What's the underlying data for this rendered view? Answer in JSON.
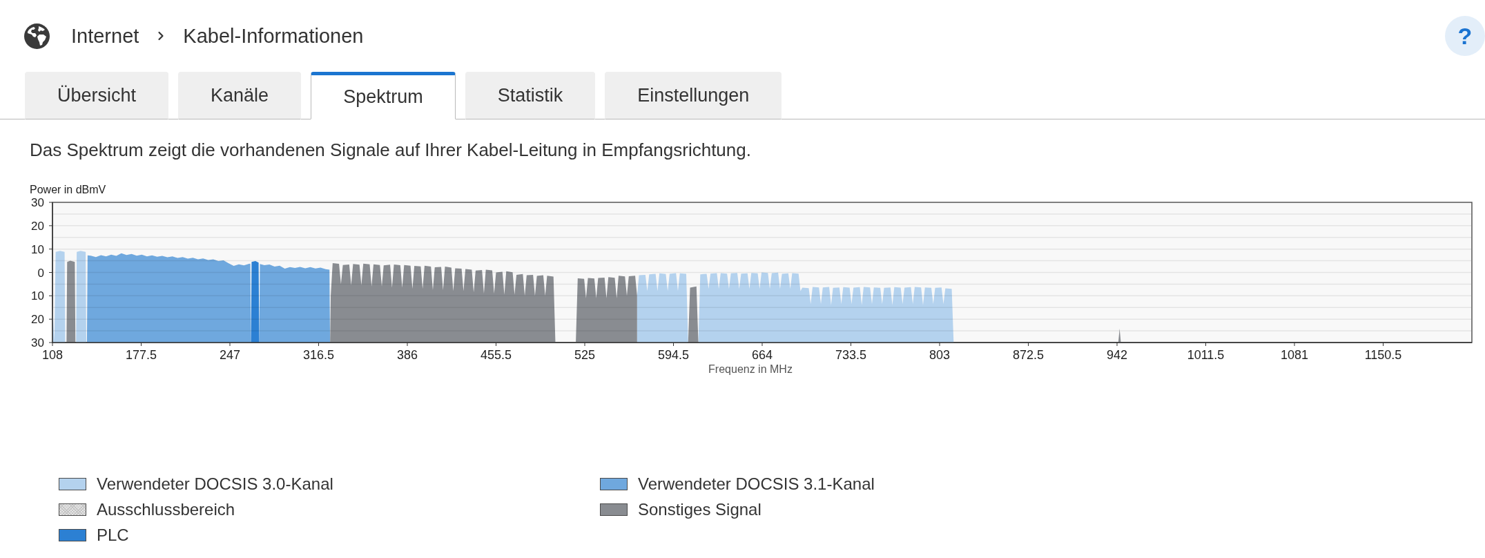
{
  "breadcrumb": [
    "Internet",
    "Kabel-Informationen"
  ],
  "help_button": {
    "label": "?"
  },
  "tabs": [
    {
      "label": "Übersicht",
      "selected": false
    },
    {
      "label": "Kanäle",
      "selected": false
    },
    {
      "label": "Spektrum",
      "selected": true
    },
    {
      "label": "Statistik",
      "selected": false
    },
    {
      "label": "Einstellungen",
      "selected": false
    }
  ],
  "description": "Das Spektrum zeigt die vorhandenen Signale auf Ihrer Kabel-Leitung in Empfangsrichtung.",
  "spectrum_chart": {
    "chart_data": {
      "type": "area",
      "grid": true,
      "xlabel": "Frequenz in MHz",
      "ylabel": "Power in dBmV",
      "xlim": [
        108,
        1220
      ],
      "ylim": [
        -30,
        30
      ],
      "xticks": [
        108,
        177.5,
        247,
        316.5,
        386,
        455.5,
        525,
        594.5,
        664,
        733.5,
        803,
        872.5,
        942,
        1011.5,
        1081,
        1150.5
      ],
      "yticks": [
        30,
        20,
        10,
        0,
        {
          "value": -10,
          "label": "10"
        },
        {
          "value": -20,
          "label": "20"
        },
        {
          "value": -30,
          "label": "30"
        }
      ],
      "x": [
        108,
        109.5,
        110.5,
        114,
        117.5,
        118,
        119,
        119.5,
        122,
        125.5,
        126,
        126.5,
        127,
        130,
        134,
        134.5,
        135,
        135.5,
        138,
        142,
        146,
        150,
        154,
        158,
        162,
        166,
        170,
        174,
        178,
        182,
        186,
        190,
        194,
        198,
        202,
        206,
        210,
        214,
        218,
        222,
        226,
        230,
        234,
        238,
        242,
        246,
        250,
        254,
        258,
        262,
        263,
        263.5,
        264,
        267,
        269.5,
        270,
        270.5,
        274,
        278,
        282,
        286,
        290,
        294,
        298,
        302,
        306,
        310,
        314,
        318,
        322,
        325,
        325.5,
        326,
        327.5,
        332.5,
        334,
        335.5,
        340.5,
        342,
        343.5,
        348.5,
        350,
        351.5,
        356.5,
        358,
        359.5,
        364.5,
        366,
        367.5,
        372.5,
        374,
        375.5,
        380.5,
        382,
        383.5,
        388.5,
        390,
        391.5,
        396.5,
        398,
        399.5,
        404.5,
        406,
        407.5,
        412.5,
        414,
        415.5,
        420.5,
        422,
        423.5,
        428.5,
        430,
        431.5,
        436.5,
        438,
        439.5,
        444.5,
        446,
        447.5,
        452.5,
        454,
        455.5,
        460.5,
        462,
        463.5,
        468.5,
        470,
        471.5,
        476.5,
        478,
        479.5,
        484.5,
        486,
        487.5,
        492.5,
        494,
        495.5,
        500.5,
        502,
        518,
        519.5,
        524.5,
        526,
        527.5,
        532.5,
        534,
        535.5,
        540.5,
        542,
        543.5,
        548.5,
        550,
        551.5,
        556.5,
        558,
        559.5,
        564.5,
        566,
        567.5,
        572.5,
        574,
        575.5,
        580.5,
        582,
        583.5,
        588.5,
        590,
        591.5,
        596.5,
        598,
        599.5,
        604.5,
        606,
        607.5,
        612.5,
        614,
        615.5,
        620.5,
        622,
        623.5,
        628.5,
        630,
        631.5,
        636.5,
        638,
        639.5,
        644.5,
        646,
        647.5,
        652.5,
        654,
        655.5,
        660.5,
        662,
        663.5,
        668.5,
        670,
        671.5,
        676.5,
        678,
        679.5,
        684.5,
        686,
        687.5,
        692.5,
        694,
        695.5,
        700.5,
        702,
        703.5,
        708.5,
        710,
        711.5,
        716.5,
        718,
        719.5,
        724.5,
        726,
        727.5,
        732.5,
        734,
        735.5,
        740.5,
        742,
        743.5,
        748.5,
        750,
        751.5,
        756.5,
        758,
        759.5,
        764.5,
        766,
        767.5,
        772.5,
        774,
        775.5,
        780.5,
        782,
        783.5,
        788.5,
        790,
        791.5,
        796.5,
        798,
        799.5,
        804.5,
        806,
        807.5,
        812.5,
        814,
        943,
        944,
        945
      ],
      "series": [
        {
          "color": "#b4d2ee",
          "values": [
            -13,
            -30,
            8.8,
            9.2,
            8.8,
            -30,
            null,
            null,
            null,
            null,
            null,
            -30,
            8.8,
            9.2,
            8.8,
            -30,
            null,
            null,
            null,
            null,
            null,
            null,
            null,
            null,
            null,
            null,
            null,
            null,
            null,
            null,
            null,
            null,
            null,
            null,
            null,
            null,
            null,
            null,
            null,
            null,
            null,
            null,
            null,
            null,
            null,
            null,
            null,
            null,
            null,
            null,
            null,
            null,
            null,
            null,
            null,
            null,
            null,
            null,
            null,
            null,
            null,
            null,
            null,
            null,
            null,
            null,
            null,
            null,
            null,
            null,
            null,
            null,
            null,
            null,
            null,
            null,
            null,
            null,
            null,
            null,
            null,
            null,
            null,
            null,
            null,
            null,
            null,
            null,
            null,
            null,
            null,
            null,
            null,
            null,
            null,
            null,
            null,
            null,
            null,
            null,
            null,
            null,
            null,
            null,
            null,
            null,
            null,
            null,
            null,
            null,
            null,
            null,
            null,
            null,
            null,
            null,
            null,
            null,
            null,
            null,
            null,
            null,
            null,
            null,
            null,
            null,
            null,
            null,
            null,
            null,
            null,
            null,
            null,
            null,
            null,
            null,
            null,
            null,
            null,
            null,
            null,
            null,
            null,
            null,
            null,
            null,
            null,
            null,
            null,
            null,
            null,
            null,
            null,
            null,
            null,
            null,
            null,
            -10,
            -1.2,
            -1,
            -8,
            -0.8,
            -0.6,
            -8,
            -0.4,
            -0.7,
            -8,
            -0.6,
            -0.3,
            -8,
            -0.4,
            -0.6,
            -30,
            null,
            null,
            -30,
            -0.8,
            -0.6,
            -7,
            -0.5,
            -0.3,
            -7,
            -0.3,
            -0.5,
            -7,
            -0.4,
            -0.2,
            -7,
            -0.5,
            -0.4,
            -7,
            -0.2,
            -0.4,
            -7,
            0,
            -0.2,
            -7,
            -0.3,
            -0.1,
            -7,
            -0.6,
            -0.4,
            -7,
            -0.3,
            -0.5,
            -8,
            -6.5,
            -6.7,
            -13.5,
            -6.2,
            -6.4,
            -13.5,
            -6.4,
            -6.2,
            -14,
            -6.6,
            -6.4,
            -13.5,
            -6.3,
            -6.5,
            -13.5,
            -6.5,
            -6.3,
            -14,
            -6.2,
            -6.4,
            -13.5,
            -6.4,
            -6.6,
            -13.5,
            -6.6,
            -6.4,
            -14,
            -6.3,
            -6.5,
            -13.5,
            -6.5,
            -6.3,
            -13.5,
            -6.2,
            -6.4,
            -14,
            -6.4,
            -6.6,
            -13.5,
            -6.6,
            -6.4,
            -13.5,
            -6.8,
            -7,
            -30,
            null,
            null,
            null
          ]
        },
        {
          "color": "#6fa8de",
          "values": [
            null,
            null,
            null,
            null,
            null,
            null,
            null,
            null,
            null,
            null,
            null,
            null,
            null,
            null,
            null,
            null,
            -30,
            7.3,
            7.2,
            6.6,
            7.4,
            6.9,
            7.6,
            7.1,
            8.2,
            7.5,
            7.9,
            7.2,
            7.6,
            6.9,
            7.3,
            6.7,
            7.1,
            6.5,
            6.9,
            6.2,
            6.6,
            5.9,
            6.3,
            5.6,
            6,
            5.3,
            5.6,
            4.9,
            5.2,
            3.9,
            2.8,
            3.5,
            3,
            3.7,
            3.8,
            -30,
            null,
            null,
            null,
            -30,
            3.6,
            3.1,
            3.4,
            2.5,
            2.9,
            1.6,
            2.3,
            1.9,
            2.4,
            1.8,
            2.3,
            1.7,
            2.1,
            1.4,
            1.2,
            -30,
            null,
            null,
            null,
            null,
            null,
            null,
            null,
            null,
            null,
            null,
            null,
            null,
            null,
            null,
            null,
            null,
            null,
            null,
            null,
            null,
            null,
            null,
            null,
            null,
            null,
            null,
            null,
            null,
            null,
            null,
            null,
            null,
            null,
            null,
            null,
            null,
            null,
            null,
            null,
            null,
            null,
            null,
            null,
            null,
            null,
            null,
            null,
            null,
            null,
            null,
            null,
            null,
            null,
            null,
            null,
            null,
            null,
            null,
            null,
            null,
            null,
            null,
            null,
            null,
            null,
            null,
            null,
            null,
            null,
            null,
            null,
            null,
            null,
            null,
            null,
            null,
            null,
            null,
            null,
            null,
            null,
            null,
            null,
            null,
            null,
            null,
            null,
            null,
            null,
            null,
            null,
            null,
            null,
            null,
            null,
            null,
            null,
            null,
            null,
            null,
            null,
            null,
            null,
            null,
            null,
            null,
            null,
            null,
            null,
            null,
            null,
            null,
            null,
            null,
            null,
            null,
            null,
            null,
            null,
            null,
            null,
            null,
            null,
            null,
            null,
            null,
            null,
            null,
            null,
            null,
            null,
            null,
            null,
            null,
            null,
            null,
            null,
            null,
            null,
            null,
            null,
            null,
            null,
            null,
            null,
            null,
            null,
            null,
            null,
            null,
            null,
            null,
            null,
            null,
            null,
            null,
            null,
            null,
            null,
            null,
            null,
            null,
            null,
            null,
            null,
            null,
            null,
            null,
            null,
            null,
            null,
            null,
            null,
            null,
            null,
            null,
            null,
            null,
            null,
            null,
            null,
            null
          ]
        },
        {
          "color": "#898c91",
          "values": [
            null,
            null,
            null,
            null,
            null,
            null,
            -30,
            4.5,
            5,
            4.5,
            -30,
            null,
            null,
            null,
            null,
            null,
            null,
            null,
            null,
            null,
            null,
            null,
            null,
            null,
            null,
            null,
            null,
            null,
            null,
            null,
            null,
            null,
            null,
            null,
            null,
            null,
            null,
            null,
            null,
            null,
            null,
            null,
            null,
            null,
            null,
            null,
            null,
            null,
            null,
            null,
            null,
            null,
            null,
            null,
            null,
            null,
            null,
            null,
            null,
            null,
            null,
            null,
            null,
            null,
            null,
            null,
            null,
            null,
            null,
            null,
            null,
            -30,
            -10,
            4,
            3.7,
            -5,
            3.2,
            3.4,
            -5.5,
            3.6,
            3.3,
            -5.5,
            3.8,
            3.5,
            -6,
            3.5,
            3.2,
            -6,
            3,
            3.3,
            -6.5,
            3.4,
            3.1,
            -6.5,
            3.2,
            2.9,
            -7,
            2.8,
            2.6,
            -7,
            2.9,
            2.5,
            -7.5,
            2.2,
            2.4,
            -7.5,
            2.5,
            2.1,
            -8,
            1.8,
            1.6,
            -8,
            1.5,
            1.2,
            -8.5,
            0.8,
            1,
            -9,
            1.2,
            0.9,
            -9,
            0,
            0.3,
            -9.5,
            0.5,
            0.1,
            -9.5,
            -1,
            -0.7,
            -10,
            -1.2,
            -1,
            -10,
            -1.5,
            -1.2,
            -10,
            -1.4,
            -1.8,
            -30,
            -30,
            -2.5,
            -2.7,
            -11,
            -2.4,
            -2.6,
            -11,
            -2.4,
            -2.2,
            -11,
            -2,
            -2.3,
            -11,
            -1.4,
            -1.7,
            -10,
            -1.6,
            -1.4,
            -10,
            null,
            null,
            null,
            null,
            null,
            null,
            null,
            null,
            null,
            null,
            null,
            null,
            null,
            null,
            -30,
            -6.5,
            -6,
            -30,
            null,
            null,
            null,
            null,
            null,
            null,
            null,
            null,
            null,
            null,
            null,
            null,
            null,
            null,
            null,
            null,
            null,
            null,
            null,
            null,
            null,
            null,
            null,
            null,
            null,
            null,
            null,
            null,
            null,
            null,
            null,
            null,
            null,
            null,
            null,
            null,
            null,
            null,
            null,
            null,
            null,
            null,
            null,
            null,
            null,
            null,
            null,
            null,
            null,
            null,
            null,
            null,
            null,
            null,
            null,
            null,
            null,
            null,
            null,
            null,
            null,
            null,
            null,
            null,
            null,
            null,
            null,
            null,
            null,
            null,
            null,
            null,
            null,
            null,
            null,
            -30,
            -24,
            -30
          ]
        },
        {
          "color": "#2c80d3",
          "values": [
            null,
            null,
            null,
            null,
            null,
            null,
            null,
            null,
            null,
            null,
            null,
            null,
            null,
            null,
            null,
            null,
            null,
            null,
            null,
            null,
            null,
            null,
            null,
            null,
            null,
            null,
            null,
            null,
            null,
            null,
            null,
            null,
            null,
            null,
            null,
            null,
            null,
            null,
            null,
            null,
            null,
            null,
            null,
            null,
            null,
            null,
            null,
            null,
            null,
            null,
            null,
            -30,
            4.5,
            4.9,
            4.2,
            -30,
            null,
            null,
            null,
            null,
            null,
            null,
            null,
            null,
            null,
            null,
            null,
            null,
            null,
            null,
            null,
            null,
            null,
            null,
            null,
            null,
            null,
            null,
            null,
            null,
            null,
            null,
            null,
            null,
            null,
            null,
            null,
            null,
            null,
            null,
            null,
            null,
            null,
            null,
            null,
            null,
            null,
            null,
            null,
            null,
            null,
            null,
            null,
            null,
            null,
            null,
            null,
            null,
            null,
            null,
            null,
            null,
            null,
            null,
            null,
            null,
            null,
            null,
            null,
            null,
            null,
            null,
            null,
            null,
            null,
            null,
            null,
            null,
            null,
            null,
            null,
            null,
            null,
            null,
            null,
            null,
            null,
            null,
            null,
            null,
            null,
            null,
            null,
            null,
            null,
            null,
            null,
            null,
            null,
            null,
            null,
            null,
            null,
            null,
            null,
            null,
            null,
            null,
            null,
            null,
            null,
            null,
            null,
            null,
            null,
            null,
            null,
            null,
            null,
            null,
            null,
            null,
            null,
            null,
            null,
            null,
            null,
            null,
            null,
            null,
            null,
            null,
            null,
            null,
            null,
            null,
            null,
            null,
            null,
            null,
            null,
            null,
            null,
            null,
            null,
            null,
            null,
            null,
            null,
            null,
            null,
            null,
            null,
            null,
            null,
            null,
            null,
            null,
            null,
            null,
            null,
            null,
            null,
            null,
            null,
            null,
            null,
            null,
            null,
            null,
            null,
            null,
            null,
            null,
            null,
            null,
            null,
            null,
            null,
            null,
            null,
            null,
            null,
            null,
            null,
            null,
            null,
            null,
            null,
            null,
            null,
            null,
            null,
            null,
            null,
            null,
            null,
            null,
            null,
            null,
            null,
            null,
            null,
            null
          ]
        }
      ]
    },
    "legend": [
      {
        "label": "Verwendeter DOCSIS 3.0-Kanal",
        "color": "#b4d2ee",
        "kind": "solid"
      },
      {
        "label": "Verwendeter DOCSIS 3.1-Kanal",
        "color": "#6fa8de",
        "kind": "solid"
      },
      {
        "label": "Ausschlussbereich",
        "color": "#e6e6e6",
        "kind": "hatched"
      },
      {
        "label": "Sonstiges Signal",
        "color": "#898c91",
        "kind": "solid"
      },
      {
        "label": "PLC",
        "color": "#2c80d3",
        "kind": "solid"
      }
    ]
  }
}
